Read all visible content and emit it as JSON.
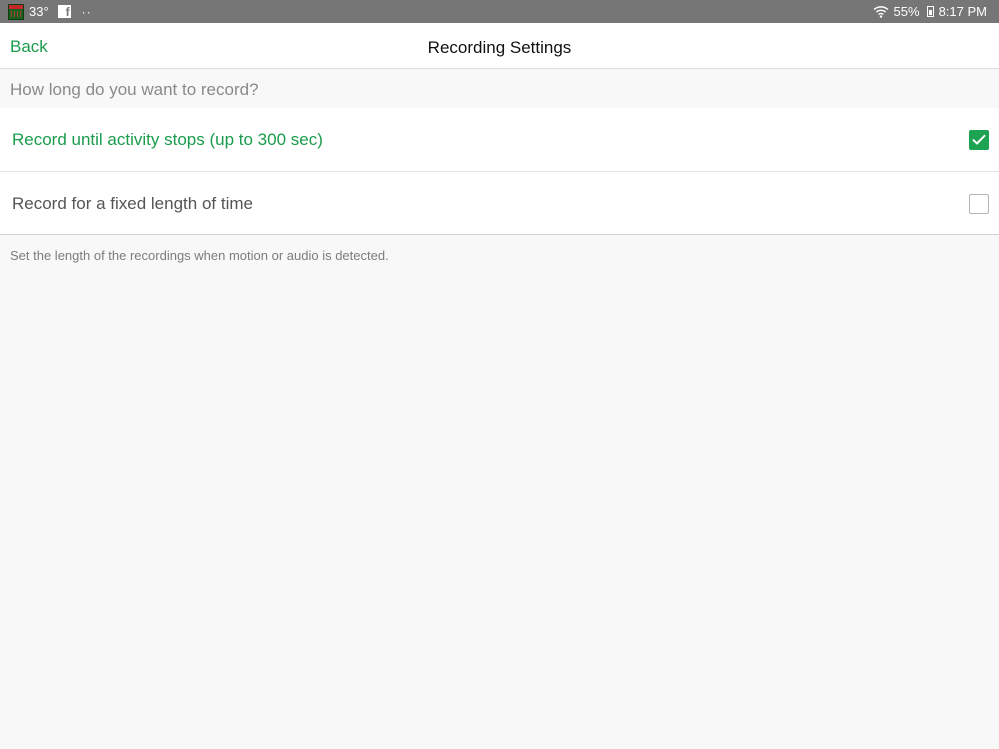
{
  "status_bar": {
    "temperature": "33°",
    "dots": "··",
    "battery_percent": "55%",
    "time": "8:17 PM"
  },
  "nav": {
    "back_label": "Back",
    "title": "Recording Settings"
  },
  "section": {
    "header": "How long do you want to record?",
    "options": [
      {
        "label": "Record until activity stops (up to 300 sec)",
        "checked": true
      },
      {
        "label": "Record for a fixed length of time",
        "checked": false
      }
    ],
    "footer": "Set the length of the recordings when motion or audio is detected."
  },
  "colors": {
    "accent": "#1a9c4c",
    "status_bar": "#767676",
    "background": "#f8f8f8"
  },
  "icons": [
    "calendar-icon",
    "facebook-icon",
    "wifi-icon",
    "battery-icon",
    "checkmark-icon"
  ]
}
